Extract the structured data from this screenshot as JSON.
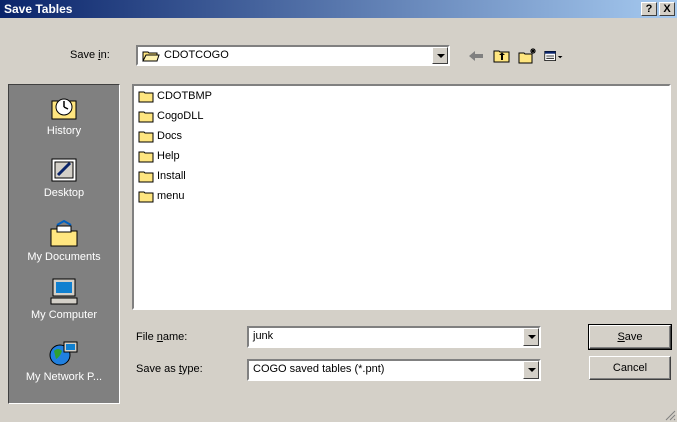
{
  "window": {
    "title": "Save Tables",
    "help_button": "?",
    "close_button": "X"
  },
  "save_in": {
    "label_pre": "Save ",
    "label_key": "i",
    "label_post": "n:",
    "value": "CDOTCOGO"
  },
  "places": [
    {
      "label": "History",
      "icon": "history-icon"
    },
    {
      "label": "Desktop",
      "icon": "desktop-icon"
    },
    {
      "label": "My Documents",
      "icon": "my-documents-icon"
    },
    {
      "label": "My Computer",
      "icon": "my-computer-icon"
    },
    {
      "label": "My Network P...",
      "icon": "my-network-places-icon"
    }
  ],
  "files": [
    {
      "name": "CDOTBMP"
    },
    {
      "name": "CogoDLL"
    },
    {
      "name": "Docs"
    },
    {
      "name": "Help"
    },
    {
      "name": "Install"
    },
    {
      "name": "menu"
    }
  ],
  "file_name": {
    "label_pre": "File ",
    "label_key": "n",
    "label_post": "ame:",
    "value": "junk"
  },
  "save_type": {
    "label_pre": "Save as ",
    "label_key": "t",
    "label_post": "ype:",
    "value": "COGO saved tables (*.pnt)"
  },
  "buttons": {
    "save_key": "S",
    "save_rest": "ave",
    "cancel": "Cancel"
  },
  "colors": {
    "titlebar_start": "#0a246a",
    "titlebar_end": "#a6caf0",
    "dialog_bg": "#d4d0c8",
    "places_bg": "#808080",
    "folder": "#ffe680"
  }
}
